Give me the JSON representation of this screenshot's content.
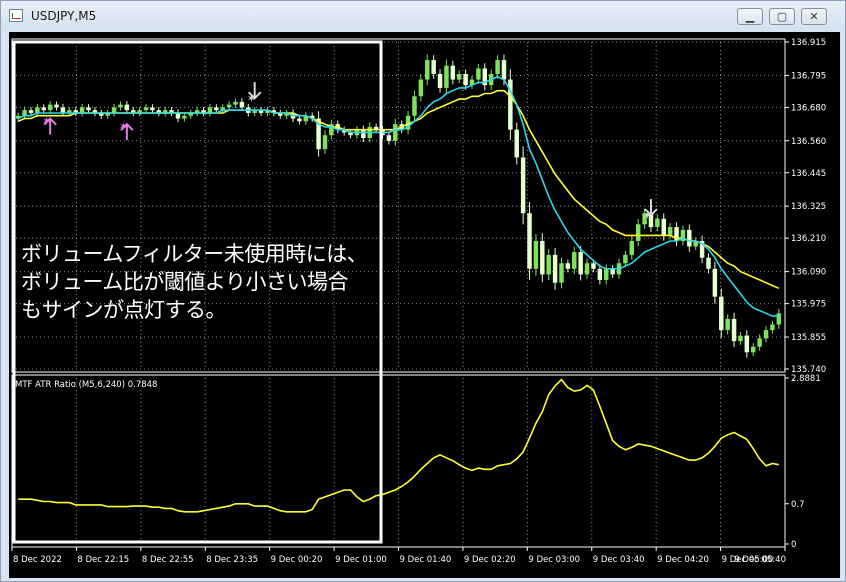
{
  "window": {
    "title": "USDJPY,M5",
    "controls": {
      "minimize": "▁",
      "maximize": "▢",
      "close": "✕"
    }
  },
  "callout_text": "ボリュームフィルター未使用時には、\nボリューム比が閾値より小さい場合\nもサインが点灯する。",
  "colors": {
    "background": "#000000",
    "grid": "#c8c8c8",
    "bull_candle": "#7ee35c",
    "bear_candle": "#e8ffd0",
    "ma_fast": "#2ad8e8",
    "ma_slow": "#ffff30",
    "atr_line": "#ffff30",
    "buy_arrow": "#e87ae8",
    "sell_arrow": "#d8d8d8",
    "callout_box": "#ffffff"
  },
  "chart_data": [
    {
      "type": "candlestick",
      "symbol": "USDJPY",
      "timeframe": "M5",
      "ylim": [
        135.74,
        136.915
      ],
      "y_ticks": [
        "136.915",
        "136.795",
        "136.680",
        "136.560",
        "136.445",
        "136.325",
        "136.210",
        "136.090",
        "135.975",
        "135.855",
        "135.740"
      ],
      "x_ticks": [
        "8 Dec 2022",
        "8 Dec 22:15",
        "8 Dec 22:55",
        "8 Dec 23:35",
        "9 Dec 00:20",
        "9 Dec 01:00",
        "9 Dec 01:40",
        "9 Dec 02:20",
        "9 Dec 03:00",
        "9 Dec 03:40",
        "9 Dec 04:20",
        "9 Dec 05:00",
        "9 Dec 05:40"
      ],
      "close": [
        136.65,
        136.67,
        136.66,
        136.68,
        136.67,
        136.69,
        136.68,
        136.66,
        136.67,
        136.66,
        136.68,
        136.67,
        136.66,
        136.65,
        136.66,
        136.68,
        136.69,
        136.67,
        136.66,
        136.67,
        136.68,
        136.67,
        136.66,
        136.67,
        136.66,
        136.64,
        136.65,
        136.66,
        136.67,
        136.66,
        136.68,
        136.67,
        136.68,
        136.69,
        136.7,
        136.68,
        136.66,
        136.67,
        136.66,
        136.67,
        136.66,
        136.65,
        136.66,
        136.64,
        136.63,
        136.65,
        136.64,
        136.53,
        136.58,
        136.62,
        136.6,
        136.59,
        136.58,
        136.6,
        136.57,
        136.61,
        136.6,
        136.58,
        136.56,
        136.62,
        136.6,
        136.65,
        136.72,
        136.78,
        136.85,
        136.8,
        136.75,
        136.83,
        136.78,
        136.8,
        136.76,
        136.78,
        136.82,
        136.76,
        136.8,
        136.85,
        136.78,
        136.6,
        136.5,
        136.3,
        136.1,
        136.2,
        136.08,
        136.15,
        136.05,
        136.12,
        136.1,
        136.16,
        136.08,
        136.12,
        136.1,
        136.06,
        136.1,
        136.08,
        136.12,
        136.15,
        136.2,
        136.26,
        136.3,
        136.25,
        136.28,
        136.22,
        136.25,
        136.2,
        136.24,
        136.18,
        136.2,
        136.14,
        136.1,
        136.0,
        135.88,
        135.92,
        135.84,
        135.86,
        135.8,
        135.82,
        135.85,
        135.88,
        135.9,
        135.94
      ],
      "ma_fast": [
        136.64,
        136.65,
        136.65,
        136.66,
        136.66,
        136.66,
        136.66,
        136.66,
        136.66,
        136.66,
        136.66,
        136.66,
        136.66,
        136.66,
        136.66,
        136.66,
        136.66,
        136.66,
        136.66,
        136.66,
        136.66,
        136.66,
        136.66,
        136.66,
        136.66,
        136.66,
        136.66,
        136.66,
        136.66,
        136.66,
        136.66,
        136.66,
        136.67,
        136.67,
        136.67,
        136.67,
        136.67,
        136.67,
        136.67,
        136.67,
        136.66,
        136.66,
        136.66,
        136.65,
        136.65,
        136.65,
        136.64,
        136.62,
        136.61,
        136.61,
        136.6,
        136.6,
        136.59,
        136.59,
        136.59,
        136.59,
        136.59,
        136.59,
        136.59,
        136.6,
        136.6,
        136.61,
        136.63,
        136.65,
        136.68,
        136.7,
        136.71,
        136.73,
        136.74,
        136.75,
        136.75,
        136.76,
        136.77,
        136.77,
        136.78,
        136.79,
        136.78,
        136.74,
        136.69,
        136.62,
        136.53,
        136.48,
        136.42,
        136.36,
        136.31,
        136.27,
        136.23,
        136.2,
        136.17,
        136.15,
        136.13,
        136.11,
        136.1,
        136.1,
        136.1,
        136.11,
        136.12,
        136.14,
        136.16,
        136.17,
        136.18,
        136.19,
        136.2,
        136.2,
        136.21,
        136.2,
        136.2,
        136.19,
        136.17,
        136.14,
        136.1,
        136.07,
        136.04,
        136.01,
        135.98,
        135.96,
        135.95,
        135.94,
        135.93,
        135.93
      ],
      "ma_slow": [
        136.63,
        136.64,
        136.64,
        136.65,
        136.65,
        136.65,
        136.65,
        136.65,
        136.65,
        136.66,
        136.66,
        136.66,
        136.66,
        136.66,
        136.66,
        136.66,
        136.66,
        136.66,
        136.66,
        136.66,
        136.66,
        136.66,
        136.66,
        136.66,
        136.66,
        136.66,
        136.66,
        136.66,
        136.66,
        136.66,
        136.66,
        136.66,
        136.66,
        136.67,
        136.67,
        136.67,
        136.67,
        136.67,
        136.67,
        136.67,
        136.66,
        136.66,
        136.66,
        136.66,
        136.65,
        136.65,
        136.64,
        136.63,
        136.62,
        136.61,
        136.61,
        136.6,
        136.6,
        136.6,
        136.6,
        136.6,
        136.6,
        136.6,
        136.6,
        136.6,
        136.61,
        136.62,
        136.63,
        136.64,
        136.66,
        136.67,
        136.68,
        136.69,
        136.7,
        136.71,
        136.71,
        136.72,
        136.72,
        136.73,
        136.73,
        136.74,
        136.74,
        136.72,
        136.69,
        136.65,
        136.6,
        136.56,
        136.52,
        136.48,
        136.44,
        136.41,
        136.38,
        136.35,
        136.33,
        136.31,
        136.29,
        136.27,
        136.26,
        136.24,
        136.23,
        136.22,
        136.22,
        136.22,
        136.22,
        136.22,
        136.22,
        136.22,
        136.22,
        136.21,
        136.21,
        136.2,
        136.2,
        136.19,
        136.18,
        136.16,
        136.14,
        136.12,
        136.11,
        136.09,
        136.08,
        136.07,
        136.06,
        136.05,
        136.04,
        136.03
      ],
      "buy_signals": [
        5,
        17
      ],
      "sell_signals": [
        37,
        99
      ]
    },
    {
      "type": "line",
      "title": "MTF ATR Ratio (M5,6,240) 0.7848",
      "ylim": [
        0,
        2.8881
      ],
      "y_ticks": [
        "2.8881",
        "0.7",
        "0"
      ],
      "values": [
        0.78,
        0.78,
        0.78,
        0.76,
        0.74,
        0.74,
        0.72,
        0.72,
        0.72,
        0.68,
        0.68,
        0.68,
        0.68,
        0.68,
        0.65,
        0.65,
        0.65,
        0.65,
        0.66,
        0.66,
        0.66,
        0.64,
        0.64,
        0.62,
        0.62,
        0.58,
        0.56,
        0.56,
        0.56,
        0.58,
        0.6,
        0.62,
        0.64,
        0.66,
        0.7,
        0.7,
        0.7,
        0.66,
        0.66,
        0.66,
        0.62,
        0.58,
        0.56,
        0.56,
        0.56,
        0.56,
        0.6,
        0.78,
        0.82,
        0.86,
        0.9,
        0.94,
        0.94,
        0.82,
        0.74,
        0.78,
        0.84,
        0.86,
        0.9,
        0.94,
        1.0,
        1.08,
        1.18,
        1.3,
        1.4,
        1.5,
        1.55,
        1.5,
        1.45,
        1.38,
        1.32,
        1.28,
        1.32,
        1.3,
        1.3,
        1.36,
        1.38,
        1.4,
        1.48,
        1.6,
        1.84,
        2.1,
        2.3,
        2.6,
        2.75,
        2.86,
        2.72,
        2.66,
        2.68,
        2.76,
        2.68,
        2.4,
        2.1,
        1.8,
        1.7,
        1.64,
        1.68,
        1.74,
        1.72,
        1.7,
        1.66,
        1.62,
        1.58,
        1.54,
        1.5,
        1.46,
        1.46,
        1.5,
        1.58,
        1.7,
        1.84,
        1.9,
        1.94,
        1.88,
        1.82,
        1.66,
        1.48,
        1.36,
        1.4,
        1.38
      ]
    }
  ]
}
